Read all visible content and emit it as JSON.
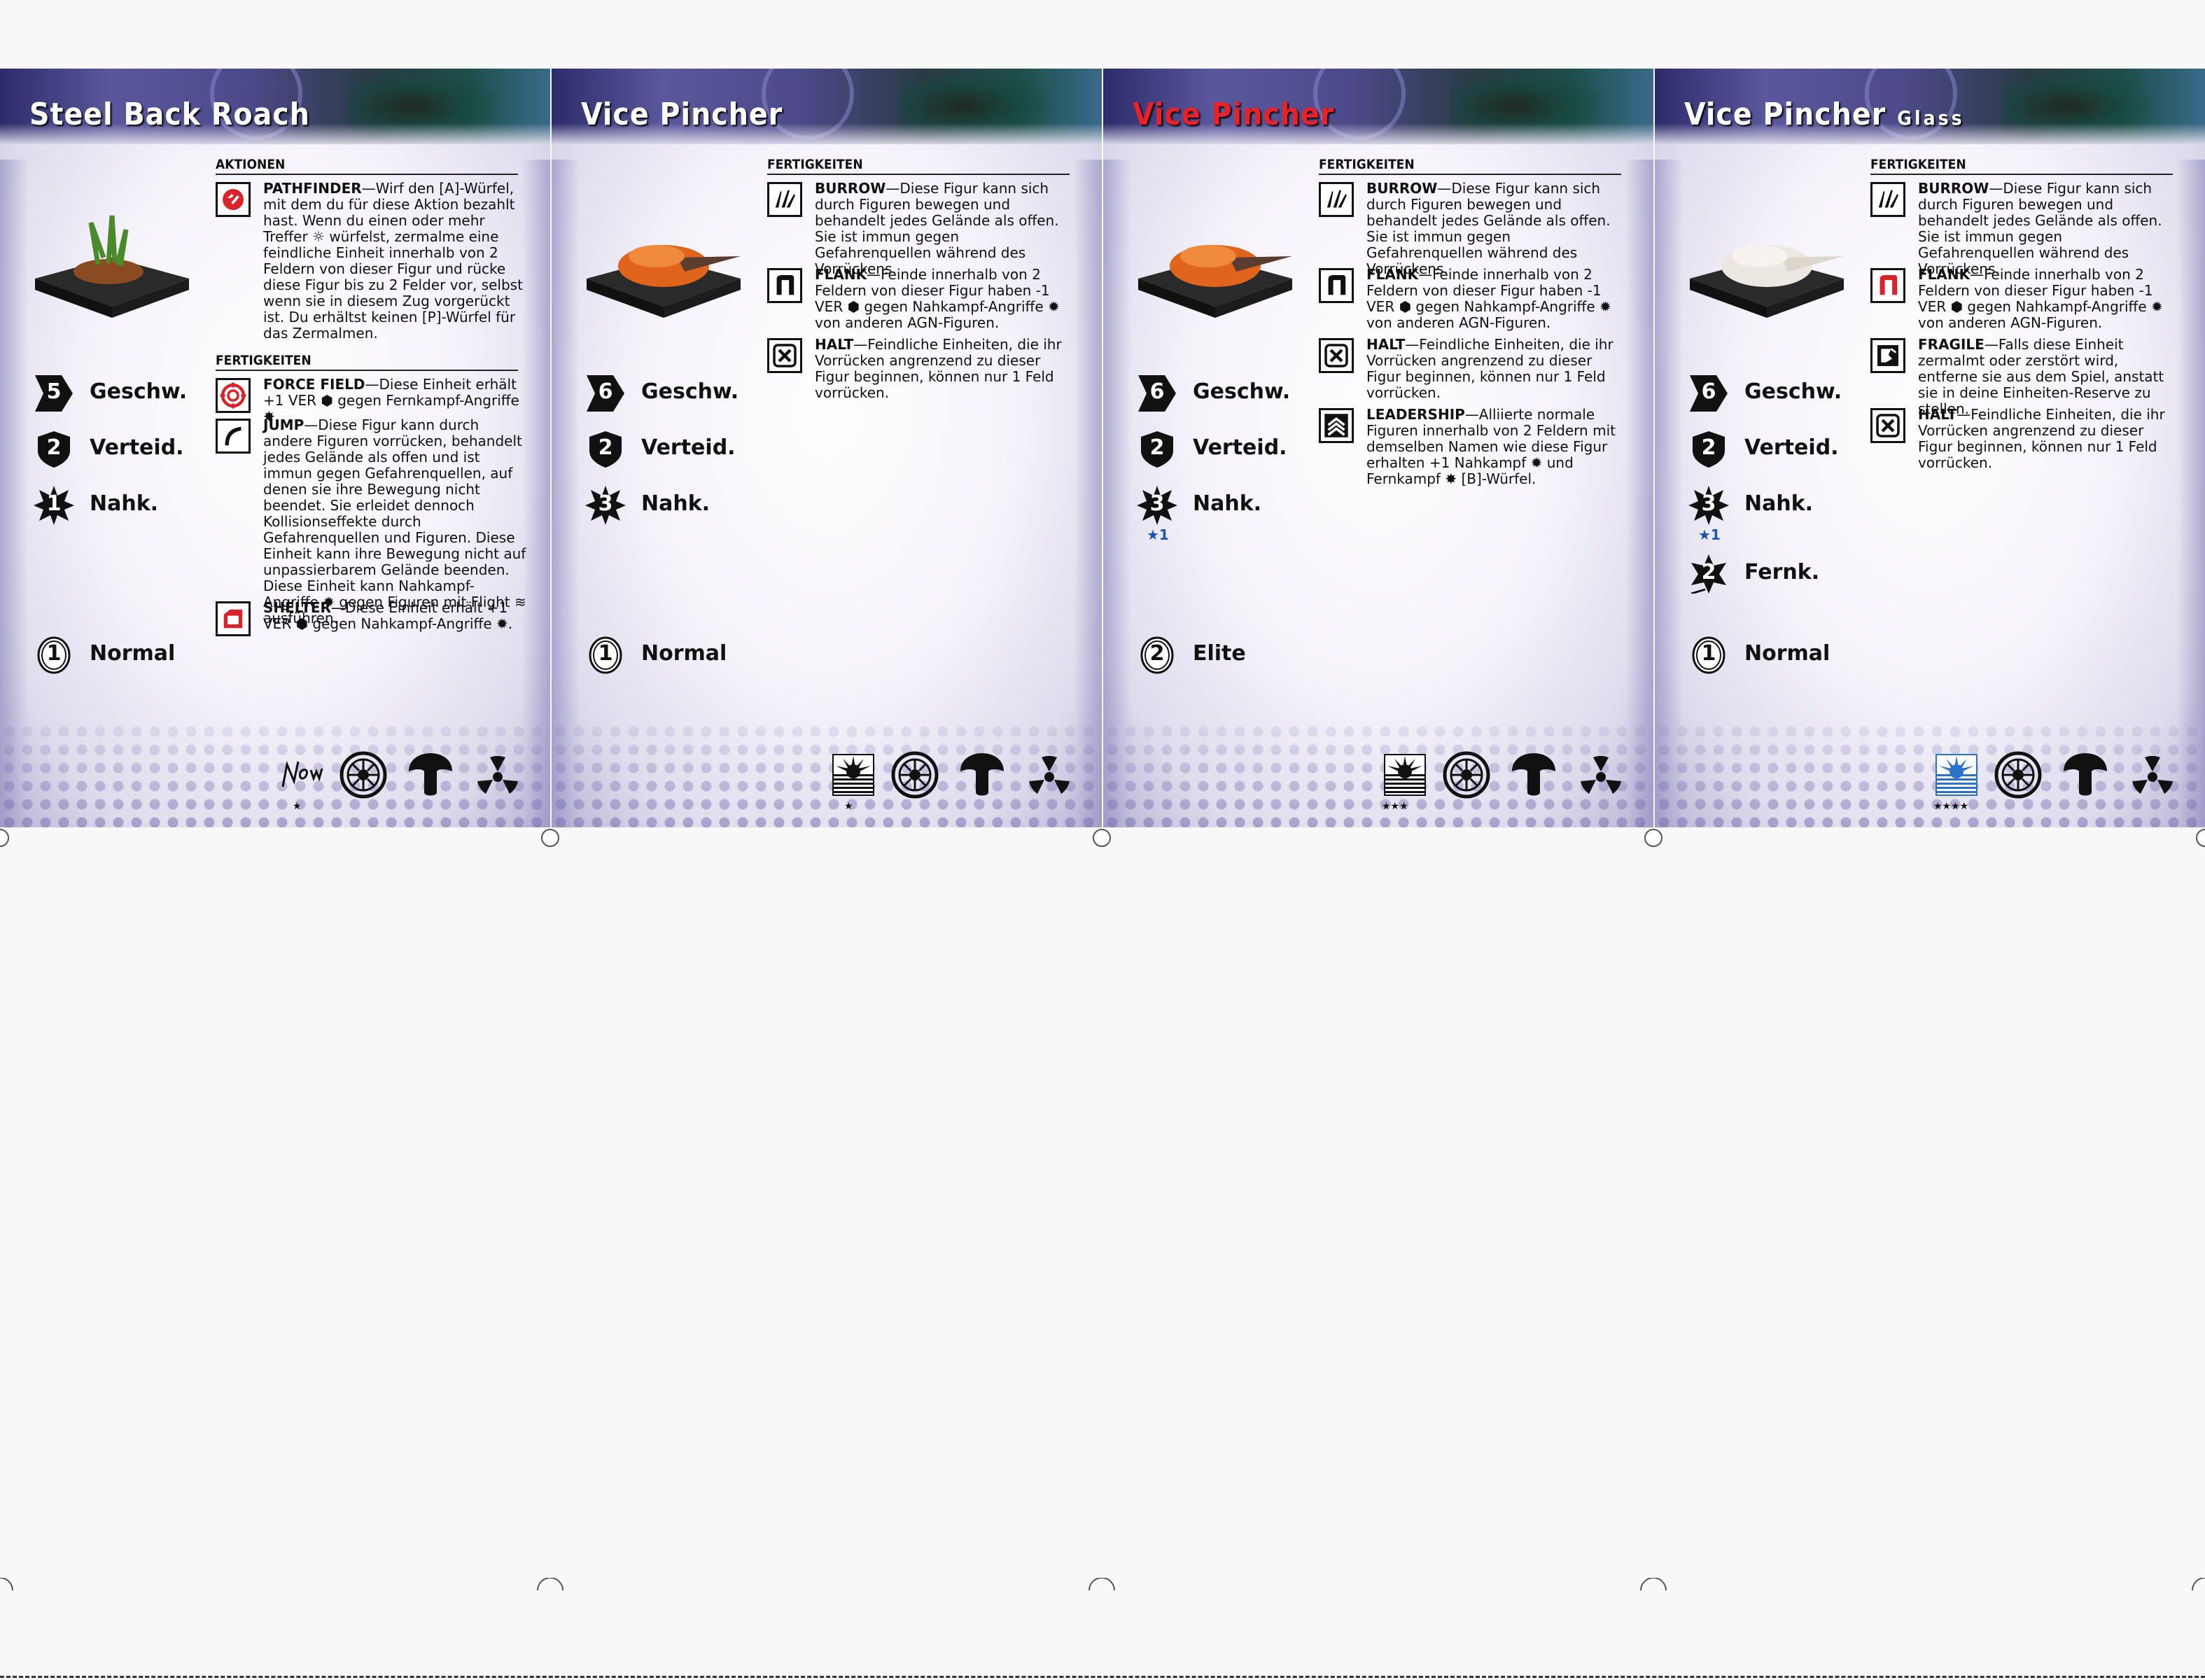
{
  "cards": [
    {
      "name": "Steel Back Roach",
      "subtitle": "",
      "title_color": "#ffffff",
      "sections": [
        {
          "header": "AKTIONEN",
          "abilities": [
            {
              "icon": "pathfinder-icon",
              "name": "PATHFINDER",
              "text": "—Wirf den [A]-Würfel, mit dem du für diese Aktion bezahlt hast. Wenn du einen oder mehr Treffer ☼ würfelst, zermalme eine feindliche Einheit innerhalb von 2 Feldern von dieser Figur und rücke diese Figur bis zu 2 Felder vor, selbst wenn sie in diesem Zug vorgerückt ist. Du erhältst keinen [P]-Würfel für das Zermalmen."
            }
          ]
        },
        {
          "header": "FERTIGKEITEN",
          "abilities": [
            {
              "icon": "force-field-icon",
              "name": "FORCE FIELD",
              "text": "—Diese Einheit erhält +1 VER ⬢ gegen Fernkampf-Angriffe ✸."
            },
            {
              "icon": "jump-icon",
              "name": "JUMP",
              "text": "—Diese Figur kann durch andere Figuren vorrücken, behandelt jedes Gelände als offen und ist immun gegen Gefahrenquellen, auf denen sie ihre Bewegung nicht beendet. Sie erleidet dennoch Kollisionseffekte durch Gefahrenquellen und Figuren. Diese Einheit kann ihre Bewegung nicht auf unpassierbarem Gelände beenden. Diese Einheit kann Nahkampf-Angriffe ✹ gegen Figuren mit Flight ≋ ausführen."
            },
            {
              "icon": "shelter-icon",
              "name": "SHELTER",
              "text": "—Diese Einheit erhält +1 VER ⬢ gegen Nahkampf-Angriffe ✹."
            }
          ]
        }
      ],
      "stats": [
        {
          "type": "speed",
          "value": "5",
          "label": "Geschw.",
          "bonus": ""
        },
        {
          "type": "defense",
          "value": "2",
          "label": "Verteid.",
          "bonus": ""
        },
        {
          "type": "melee",
          "value": "1",
          "label": "Nahk.",
          "bonus": ""
        }
      ],
      "rank": {
        "value": "1",
        "label": "Normal"
      },
      "faction_stars": "★",
      "faction_icon": "now-logo-icon"
    },
    {
      "name": "Vice Pincher",
      "subtitle": "",
      "title_color": "#ffffff",
      "sections": [
        {
          "header": "FERTIGKEITEN",
          "abilities": [
            {
              "icon": "burrow-icon",
              "name": "BURROW",
              "text": "—Diese Figur kann sich durch Figuren bewegen und behandelt jedes Gelände als offen. Sie ist immun gegen Gefahrenquellen während des Vorrückens."
            },
            {
              "icon": "flank-icon",
              "name": "FLANK",
              "text": "—Feinde innerhalb von 2 Feldern von dieser Figur haben -1 VER ⬢ gegen Nahkampf-Angriffe ✹ von anderen AGN-Figuren."
            },
            {
              "icon": "halt-icon",
              "name": "HALT",
              "text": "—Feindliche Einheiten, die ihr Vorrücken angrenzend zu dieser Figur beginnen, können nur 1 Feld vorrücken."
            }
          ]
        }
      ],
      "stats": [
        {
          "type": "speed",
          "value": "6",
          "label": "Geschw.",
          "bonus": ""
        },
        {
          "type": "defense",
          "value": "2",
          "label": "Verteid.",
          "bonus": ""
        },
        {
          "type": "melee",
          "value": "3",
          "label": "Nahk.",
          "bonus": ""
        }
      ],
      "rank": {
        "value": "1",
        "label": "Normal"
      },
      "faction_stars": "★",
      "faction_icon": "sunburst-icon"
    },
    {
      "name": "Vice Pincher",
      "subtitle": "",
      "title_color": "#e8222a",
      "sections": [
        {
          "header": "FERTIGKEITEN",
          "abilities": [
            {
              "icon": "burrow-icon",
              "name": "BURROW",
              "text": "—Diese Figur kann sich durch Figuren bewegen und behandelt jedes Gelände als offen. Sie ist immun gegen Gefahrenquellen während des Vorrückens."
            },
            {
              "icon": "flank-icon",
              "name": "FLANK",
              "text": "—Feinde innerhalb von 2 Feldern von dieser Figur haben -1 VER ⬢ gegen Nahkampf-Angriffe ✹ von anderen AGN-Figuren."
            },
            {
              "icon": "halt-icon",
              "name": "HALT",
              "text": "—Feindliche Einheiten, die ihr Vorrücken angrenzend zu dieser Figur beginnen, können nur 1 Feld vorrücken."
            },
            {
              "icon": "leadership-icon",
              "name": "LEADERSHIP",
              "text": "—Alliierte normale Figuren innerhalb von 2 Feldern mit demselben Namen wie diese Figur erhalten +1 Nahkampf ✹ und Fernkampf ✸ [B]-Würfel."
            }
          ]
        }
      ],
      "stats": [
        {
          "type": "speed",
          "value": "6",
          "label": "Geschw.",
          "bonus": ""
        },
        {
          "type": "defense",
          "value": "2",
          "label": "Verteid.",
          "bonus": ""
        },
        {
          "type": "melee",
          "value": "3",
          "label": "Nahk.",
          "bonus": "★1"
        }
      ],
      "rank": {
        "value": "2",
        "label": "Elite"
      },
      "faction_stars": "★★★",
      "faction_icon": "sunburst-icon"
    },
    {
      "name": "Vice Pincher",
      "subtitle": "Glass",
      "title_color": "#ffffff",
      "sections": [
        {
          "header": "FERTIGKEITEN",
          "abilities": [
            {
              "icon": "burrow-icon",
              "name": "BURROW",
              "text": "—Diese Figur kann sich durch Figuren bewegen und behandelt jedes Gelände als offen. Sie ist immun gegen Gefahrenquellen während des Vorrückens."
            },
            {
              "icon": "flank-red-icon",
              "name": "FLANK",
              "text": "—Feinde innerhalb von 2 Feldern von dieser Figur haben -1 VER ⬢ gegen Nahkampf-Angriffe ✹ von anderen AGN-Figuren."
            },
            {
              "icon": "fragile-icon",
              "name": "FRAGILE",
              "text": "—Falls diese Einheit zermalmt oder zerstört wird, entferne sie aus dem Spiel, anstatt sie in deine Einheiten-Reserve zu stellen."
            },
            {
              "icon": "halt-icon",
              "name": "HALT",
              "text": "—Feindliche Einheiten, die ihr Vorrücken angrenzend zu dieser Figur beginnen, können nur 1 Feld vorrücken."
            }
          ]
        }
      ],
      "stats": [
        {
          "type": "speed",
          "value": "6",
          "label": "Geschw.",
          "bonus": ""
        },
        {
          "type": "defense",
          "value": "2",
          "label": "Verteid.",
          "bonus": ""
        },
        {
          "type": "melee",
          "value": "3",
          "label": "Nahk.",
          "bonus": "★1"
        },
        {
          "type": "ranged",
          "value": "2",
          "label": "Fernk.",
          "bonus": ""
        }
      ],
      "rank": {
        "value": "1",
        "label": "Normal"
      },
      "faction_stars": "★★★★",
      "faction_icon": "sunburst-blue-icon"
    }
  ],
  "colors": {
    "banner_dark": "#2c2b6a",
    "title_red": "#e8222a",
    "bonus_blue": "#1a52b8",
    "icon_red": "#d9232a"
  }
}
